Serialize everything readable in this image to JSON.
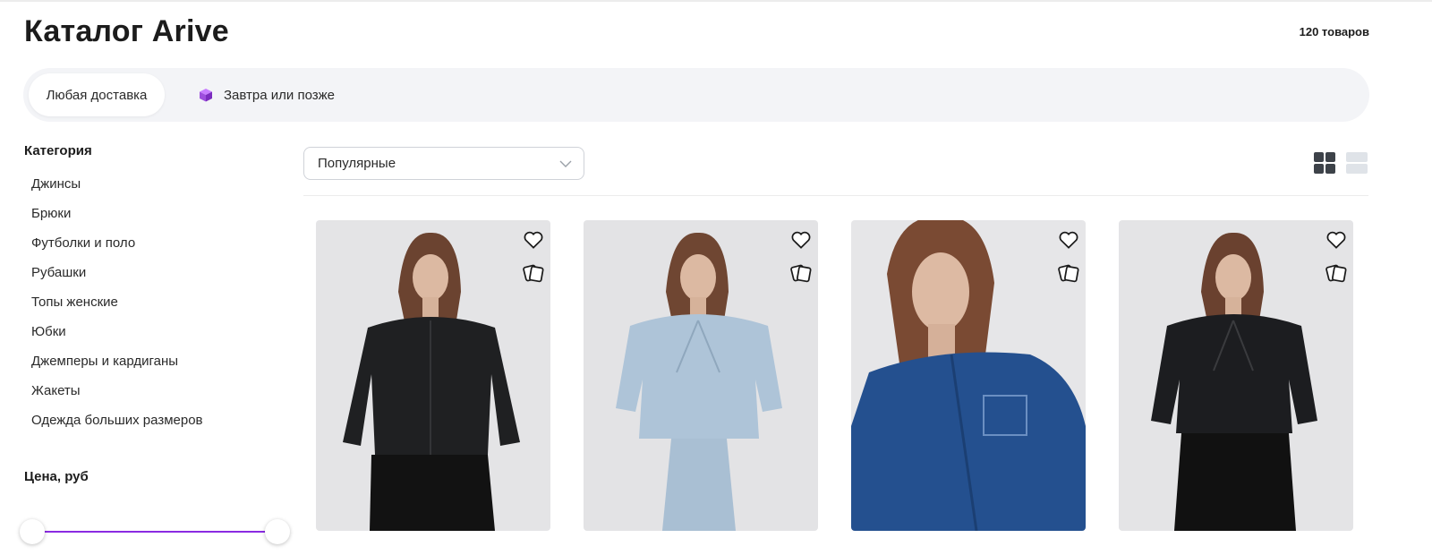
{
  "header": {
    "title": "Каталог Arive",
    "count": "120 товаров"
  },
  "delivery": {
    "options": [
      {
        "label": "Любая доставка",
        "selected": true
      },
      {
        "label": "Завтра или позже",
        "selected": false,
        "icon": "purple-cube-icon"
      }
    ]
  },
  "sidebar": {
    "category_title": "Категория",
    "categories": [
      "Джинсы",
      "Брюки",
      "Футболки и поло",
      "Рубашки",
      "Топы женские",
      "Юбки",
      "Джемперы и кардиганы",
      "Жакеты",
      "Одежда больших размеров"
    ],
    "price_title": "Цена, руб",
    "price_slider": {
      "min_fraction": 0,
      "max_fraction": 1
    }
  },
  "toolbar": {
    "sort_value": "Популярные",
    "view_modes": [
      "grid-view-icon",
      "list-view-icon"
    ],
    "active_view": "grid"
  },
  "products": [
    {
      "image": "black-denim-jacket",
      "jacket_color": "#1f2022",
      "pants_color": "#121212"
    },
    {
      "image": "light-blue-cropped-denim-jacket",
      "jacket_color": "#aec4d8",
      "pants_color": "#a9bfd3"
    },
    {
      "image": "blue-denim-jacket-closeup",
      "jacket_color": "#24508f",
      "pants_color": "#24508f"
    },
    {
      "image": "black-cropped-denim-jacket",
      "jacket_color": "#1c1d20",
      "pants_color": "#111111"
    }
  ],
  "colors": {
    "accent": "#8a2be2",
    "page_bg": "#ffffff",
    "delivery_bar_bg": "#f3f4f7"
  }
}
